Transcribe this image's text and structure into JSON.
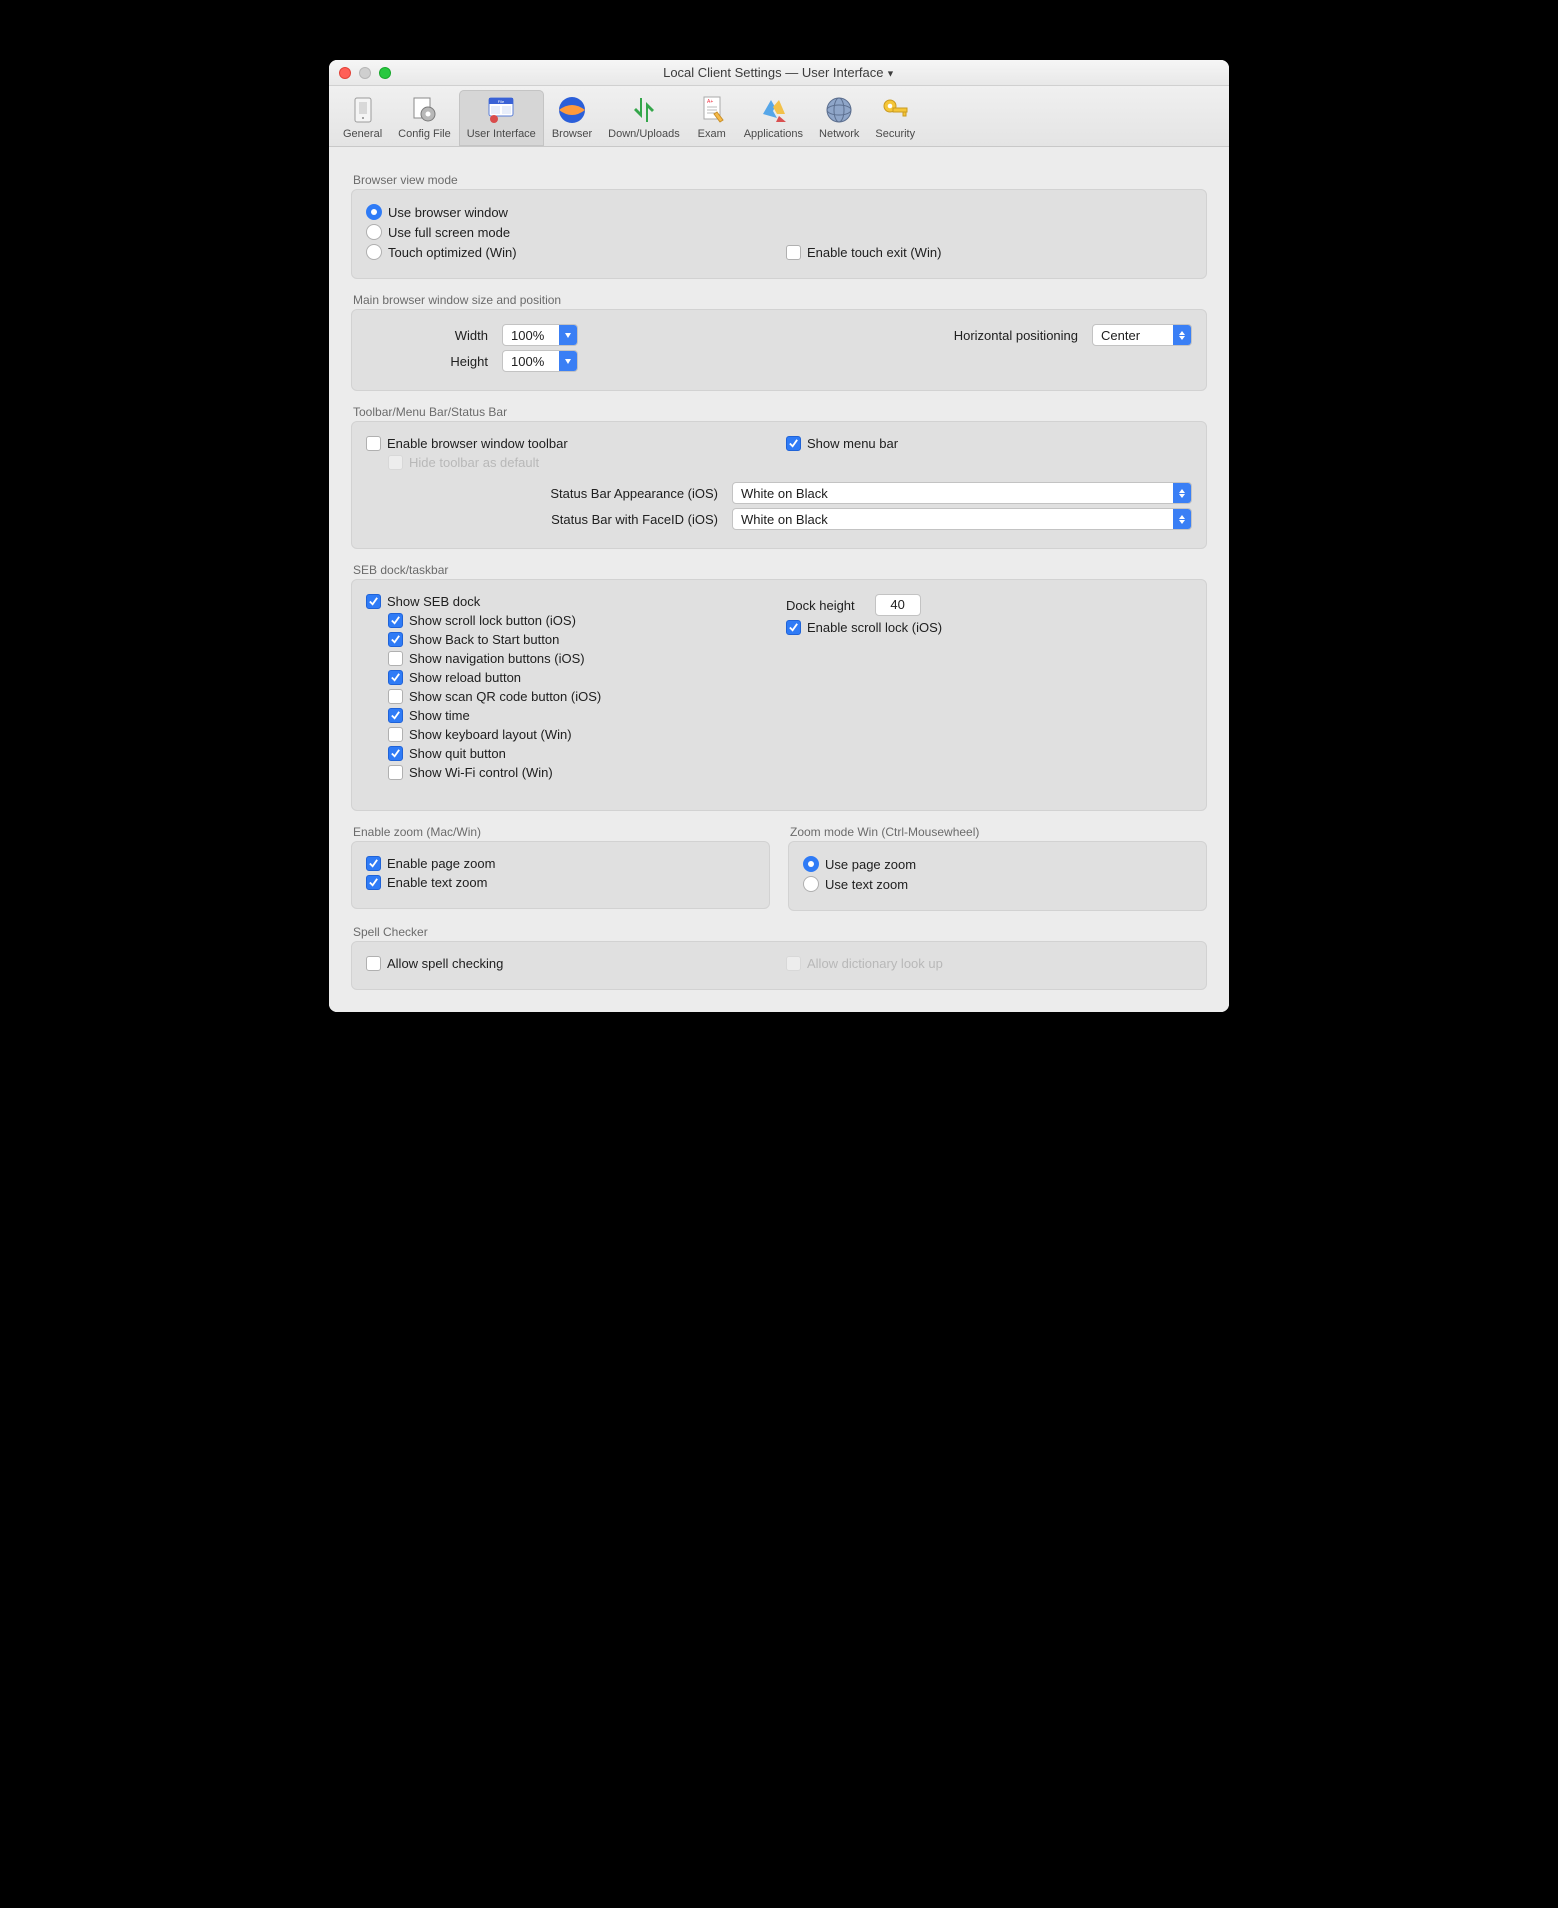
{
  "title": "Local Client Settings  —  User Interface",
  "toolbar": {
    "items": [
      {
        "label": "General"
      },
      {
        "label": "Config File"
      },
      {
        "label": "User Interface"
      },
      {
        "label": "Browser"
      },
      {
        "label": "Down/Uploads"
      },
      {
        "label": "Exam"
      },
      {
        "label": "Applications"
      },
      {
        "label": "Network"
      },
      {
        "label": "Security"
      }
    ]
  },
  "browser_view": {
    "section": "Browser view mode",
    "opt_window": "Use browser window",
    "opt_full": "Use full screen mode",
    "opt_touch": "Touch optimized (Win)",
    "enable_touch_exit": "Enable touch exit (Win)"
  },
  "win_size": {
    "section": "Main browser window size and position",
    "width_lbl": "Width",
    "width_val": "100%",
    "height_lbl": "Height",
    "height_val": "100%",
    "hpos_lbl": "Horizontal positioning",
    "hpos_val": "Center"
  },
  "bars": {
    "section": "Toolbar/Menu Bar/Status Bar",
    "enable_toolbar": "Enable browser window toolbar",
    "hide_toolbar": "Hide toolbar as default",
    "show_menu": "Show menu bar",
    "status_ios_lbl": "Status Bar Appearance (iOS)",
    "status_ios_val": "White on Black",
    "status_faceid_lbl": "Status Bar with FaceID (iOS)",
    "status_faceid_val": "White on Black"
  },
  "dock": {
    "section": "SEB dock/taskbar",
    "show_dock": "Show SEB dock",
    "scroll_lock": "Show scroll lock button (iOS)",
    "back_start": "Show Back to Start button",
    "nav": "Show navigation buttons (iOS)",
    "reload": "Show reload button",
    "qr": "Show scan QR code button (iOS)",
    "time": "Show time",
    "kbd": "Show keyboard layout (Win)",
    "quit": "Show quit button",
    "wifi": "Show Wi-Fi control (Win)",
    "height_lbl": "Dock height",
    "height_val": "40",
    "enable_scroll": "Enable scroll lock (iOS)"
  },
  "zoom": {
    "section": "Enable zoom (Mac/Win)",
    "page": "Enable page zoom",
    "text": "Enable text zoom"
  },
  "zoom_mode": {
    "section": "Zoom mode Win (Ctrl-Mousewheel)",
    "page": "Use page zoom",
    "text": "Use text zoom"
  },
  "spell": {
    "section": "Spell Checker",
    "allow": "Allow spell checking",
    "dict": "Allow dictionary look up"
  }
}
